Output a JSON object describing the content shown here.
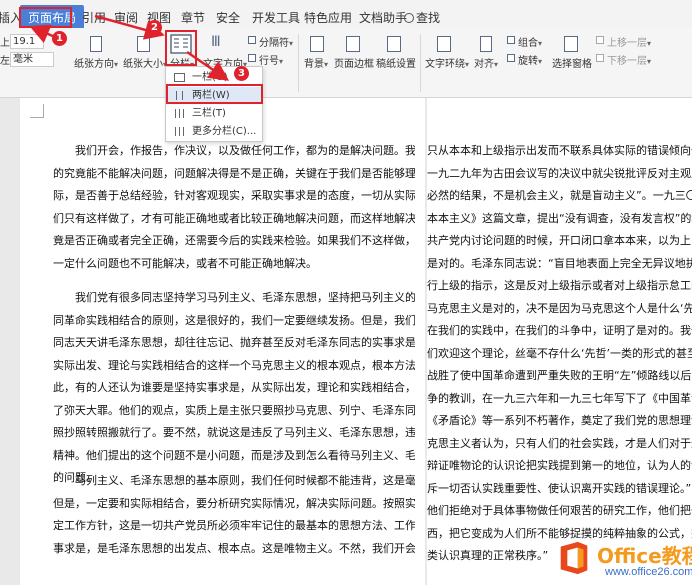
{
  "menu": {
    "insert": "插入",
    "page_layout": "页面布局",
    "reference": "引用",
    "review": "审阅",
    "view": "视图",
    "section": "章节",
    "security": "安全",
    "dev_tools": "开发工具",
    "features": "特色应用",
    "doc_helper": "文档助手",
    "search": "查找"
  },
  "ribbon": {
    "margin_top_value": "19.1",
    "margin_unit_value": "毫米",
    "orientation_label": "纸张方向",
    "size_label": "纸张大小",
    "columns_label": "分栏",
    "text_direction_label": "文字方向",
    "section_break_label": "分隔符",
    "line_number_label": "行号",
    "background_label": "背景",
    "page_border_label": "页面边框",
    "manuscript_label": "稿纸设置",
    "wrap_text_label": "文字环绕",
    "align_label": "对齐",
    "group_label": "组合",
    "rotate_label": "旋转",
    "select_pane_label": "选择窗格",
    "bring_forward_label": "上移一层",
    "send_backward_label": "下移一层"
  },
  "column_menu": {
    "one": "一栏(O)",
    "two": "两栏(W)",
    "three": "三栏(T)",
    "more": "更多分栏(C)..."
  },
  "badges": {
    "one": "1",
    "two": "2",
    "three": "3"
  },
  "page1": {
    "p1_lines": [
      "我们开会，作报告，作决议，以及做任何工作，都为的是解决问题。我们说的做",
      "的究竟能不能解决问题，问题解决得是不是正确，关键在于我们是否能够理论联系实",
      "际，是否善于总结经验，针对客观现实，采取实事求是的态度，一切从实际出发。我",
      "们只有这样做了，才有可能正确地或者比较正确地解决问题，而这样地解决问题，究",
      "竟是否正确或者完全正确，还需要今后的实践来检验。如果我们不这样做，那我们就",
      "一定什么问题也不可能解决，或者不可能正确地解决。"
    ],
    "p2_lines": [
      "我们党有很多同志坚持学习马列主义、毛泽东思想，坚持把马列主义的普遍真理",
      "同革命实践相结合的原则，这是很好的，我们一定要继续发扬。但是，我们也有一些",
      "同志天天讲毛泽东思想，却往往忘记、抛弃甚至反对毛泽东同志的实事求是、一切从",
      "实际出发、理论与实践相结合的这样一个马克思主义的根本观点，根本方法。不但如",
      "此，有的人还认为谁要是坚持实事求是，从实际出发，理论和实践相结合，谁就是犯",
      "了弥天大罪。他们的观点，实质上是主张只要照抄马克思、列宁、毛泽东同志的原话，",
      "照抄照转照搬就行了。要不然，就说这是违反了马列主义、毛泽东思想，违反了中央",
      "精神。他们提出的这个问题不是小问题，而是涉及到怎么看待马列主义、毛泽东思想",
      "的问题。"
    ],
    "p3_lines": [
      "马列主义、毛泽东思想的基本原则，我们任何时候都不能违背，这是毫无疑义的。",
      "但是，一定要和实际相结合，要分析研究实际情况，解决实际问题。按照实际情况决",
      "定工作方针，这是一切共产党员所必须牢牢记住的最基本的思想方法、工作方法。实",
      "事求是，是毛泽东思想的出发点、根本点。这是唯物主义。不然，我们开会就只能讲"
    ]
  },
  "page2": {
    "lines": [
      "只从本本和上级指示出发而不联系具体实际的错误倾向作坚",
      "一九二九年为古田会议写的决议中就尖锐批评反对主观主义",
      "必然的结果，不是机会主义，就是盲动主义”。一九三〇年，",
      "本本主义》这篇文章，提出“没有调查，没有发言权”的科",
      "共产党内讨论问题的时候，开口闭口拿本本来，以为上了书的",
      "是对的。毛泽东同志说：“盲目地表面上完全无异议地执行上级的",
      "行上级的指示，这是反对上级指示或者对上级指示怠工的最妙",
      "马克思主义是对的，决不是因为马克思这个人是什么‘先哲’",
      "在我们的实践中，在我们的斗争中，证明了是对的。我们的斗",
      "们欢迎这个理论，丝毫不存什么‘先哲’一类的形式的甚至",
      "战胜了使中国革命遭到严重失败的王明“左”倾路线以后，毛",
      "争的教训，在一九三六年和一九三七年写下了《中国革命战争",
      "《矛盾论》等一系列不朽著作，奠定了我们党的思想理论基础",
      "克思主义者认为，只有人们的社会实践，才是人们对于外界认",
      "辩证唯物论的认识论把实践提到第一的地位，认为人的认识一",
      "斥一切否认实践重要性、使认识离开实践的错误理论。”“我",
      "他们拒绝对于具体事物做任何艰苦的研究工作，他们把一般真",
      "西，把它变成为人们所不能够捉摸的纯粹抽象的公式，完全否",
      "类认识真理的正常秩序。”"
    ]
  },
  "watermark": {
    "brand": "Office教程网",
    "url": "www.office26.com"
  }
}
